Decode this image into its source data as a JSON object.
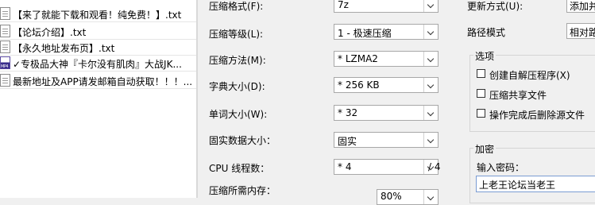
{
  "file_list": [
    {
      "name": "【来了就能下载和观看！纯免费！】.txt",
      "icon": "text-file-icon"
    },
    {
      "name": "【论坛介绍】.txt",
      "icon": "text-file-icon"
    },
    {
      "name": "【永久地址发布页】.txt",
      "icon": "text-file-icon"
    },
    {
      "name": "✓专极品大神『卡尔没有肌肉』大战JK...",
      "icon": "mp4-file-icon"
    },
    {
      "name": "最新地址及APP请发邮箱自动获取！！！...",
      "icon": "text-file-icon"
    }
  ],
  "form": {
    "format_label": "压缩格式(F):",
    "format_value": "7z",
    "level_label": "压缩等级(L):",
    "level_value": "1 - 极速压缩",
    "method_label": "压缩方法(M):",
    "method_value": "* LZMA2",
    "dict_label": "字典大小(D):",
    "dict_value": "* 256 KB",
    "word_label": "单词大小(W):",
    "word_value": "* 32",
    "solid_label": "固实数据大小：",
    "solid_value": "固实",
    "cpu_label": "CPU 线程数：",
    "cpu_value": "* 4",
    "cpu_total": "/ 4",
    "memory_label": "压缩所需内存：",
    "memory_value": "80%"
  },
  "right": {
    "update_label": "更新方式(U):",
    "update_value": "添加并",
    "path_label": "路径模式",
    "path_value": "相对路",
    "options_title": "选项",
    "options": [
      {
        "label": "创建自解压程序(X)",
        "checked": false
      },
      {
        "label": "压缩共享文件",
        "checked": false
      },
      {
        "label": "操作完成后删除源文件",
        "checked": false
      }
    ],
    "encryption_title": "加密",
    "password_label": "输入密码：",
    "password_value": "上老王论坛当老王"
  }
}
